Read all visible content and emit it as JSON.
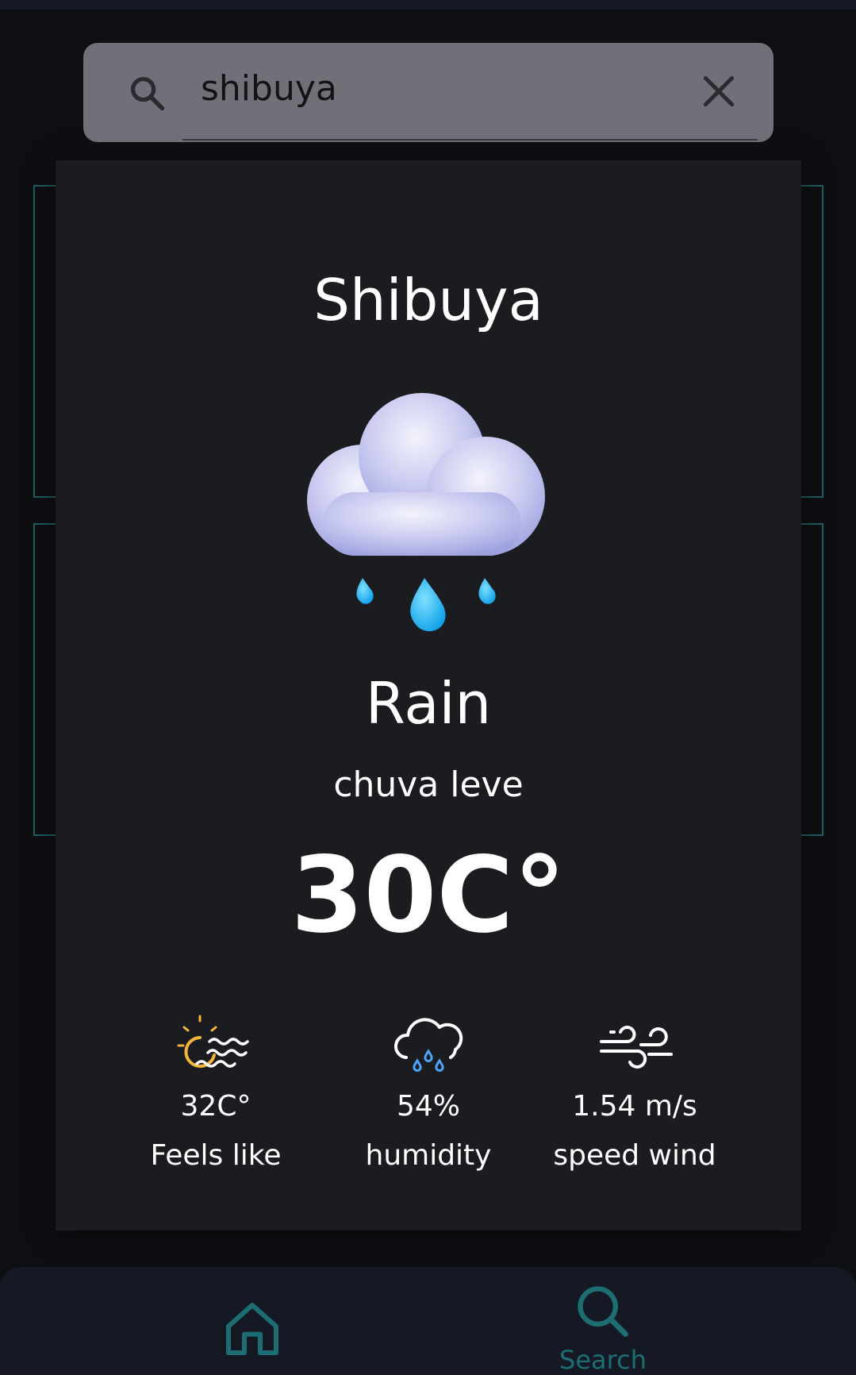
{
  "search": {
    "query": "shibuya"
  },
  "weather": {
    "city": "Shibuya",
    "condition": "Rain",
    "description": "chuva leve",
    "temperature": "30C°",
    "condition_icon": "rain-cloud-icon",
    "stats": [
      {
        "icon": "sun-haze-icon",
        "value": "32C°",
        "label": "Feels like"
      },
      {
        "icon": "cloud-rain-icon",
        "value": "54%",
        "label": "humidity"
      },
      {
        "icon": "wind-icon",
        "value": "1.54 m/s",
        "label": "speed wind"
      }
    ]
  },
  "nav": {
    "items": [
      {
        "icon": "home-icon",
        "label": ""
      },
      {
        "icon": "search-icon",
        "label": "Search"
      }
    ]
  },
  "colors": {
    "background": "#0e0f12",
    "modal": "#1b1c20",
    "accent": "#1d6e73",
    "search_bar": "#6f7078"
  }
}
